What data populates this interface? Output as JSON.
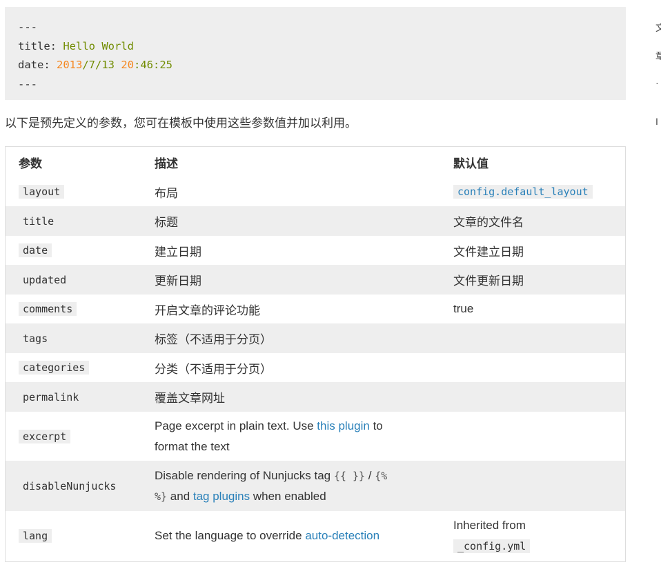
{
  "code_block": {
    "line1": "---",
    "line2_key": "title: ",
    "line2_val": "Hello World",
    "line3_key": "date: ",
    "line3_v1": "2013",
    "line3_v2": "/7/13 ",
    "line3_v3": "20",
    "line3_v4": ":46:25",
    "line4": "---"
  },
  "intro_text": "以下是预先定义的参数，您可在模板中使用这些参数值并加以利用。",
  "table": {
    "headers": [
      "参数",
      "描述",
      "默认值"
    ],
    "rows": [
      {
        "param": "layout",
        "desc": "布局",
        "default": "config.default_layout"
      },
      {
        "param": "title",
        "desc": "标题",
        "default": "文章的文件名"
      },
      {
        "param": "date",
        "desc": "建立日期",
        "default": "文件建立日期"
      },
      {
        "param": "updated",
        "desc": "更新日期",
        "default": "文件更新日期"
      },
      {
        "param": "comments",
        "desc": "开启文章的评论功能",
        "default": "true"
      },
      {
        "param": "tags",
        "desc": "标签（不适用于分页）",
        "default": ""
      },
      {
        "param": "categories",
        "desc": "分类（不适用于分页）",
        "default": ""
      },
      {
        "param": "permalink",
        "desc": "覆盖文章网址",
        "default": ""
      },
      {
        "param": "excerpt",
        "desc_a": "Page excerpt in plain text. Use ",
        "desc_link": "this plugin",
        "desc_b": " to",
        "desc_c": "format the text",
        "default": ""
      },
      {
        "param": "disableNunjucks",
        "desc_a": "Disable rendering of Nunjucks tag ",
        "desc_code1": "{{ }}",
        "desc_sep": " / ",
        "desc_code2a": "{%",
        "desc_code2b": "%}",
        "desc_b": " and ",
        "desc_link": "tag plugins",
        "desc_c": " when enabled",
        "default": ""
      },
      {
        "param": "lang",
        "desc_a": "Set the language to override ",
        "desc_link": "auto-detection",
        "default_a": "Inherited from",
        "default_code": "_config.yml"
      }
    ]
  },
  "sidebar_glyphs": [
    "文",
    "章",
    "·",
    "I"
  ]
}
